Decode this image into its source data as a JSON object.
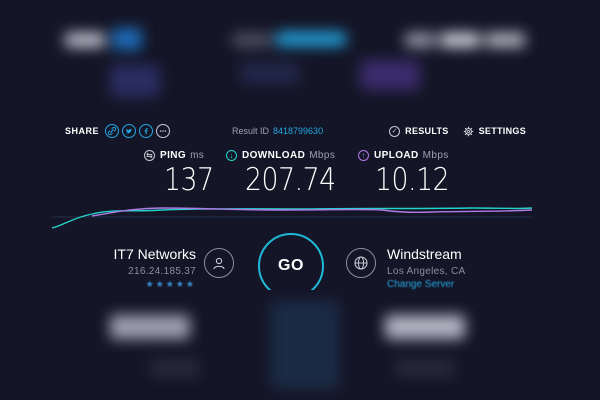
{
  "share": {
    "label": "SHARE",
    "buttons": [
      {
        "icon": "link-icon",
        "name": "share-link-button"
      },
      {
        "icon": "twitter-icon",
        "name": "share-twitter-button"
      },
      {
        "icon": "facebook-icon",
        "name": "share-facebook-button"
      },
      {
        "icon": "more-icon",
        "name": "share-more-button"
      }
    ]
  },
  "result": {
    "label": "Result ID",
    "id": "8418799630"
  },
  "nav": {
    "results_label": "RESULTS",
    "settings_label": "SETTINGS"
  },
  "metrics": {
    "ping": {
      "label": "PING",
      "unit": "ms",
      "value": "137"
    },
    "download": {
      "label": "DOWNLOAD",
      "unit": "Mbps",
      "value": "207.74"
    },
    "upload": {
      "label": "UPLOAD",
      "unit": "Mbps",
      "value": "10.12"
    }
  },
  "provider": {
    "name": "IT7 Networks",
    "ip": "216.24.185.37",
    "rating": 5
  },
  "server": {
    "name": "Windstream",
    "location": "Los Angeles, CA",
    "change_label": "Change Server"
  },
  "go_button": {
    "label": "GO"
  },
  "colors": {
    "background": "#141526",
    "accent_blue": "#23a7e3",
    "download_teal": "#23d3c8",
    "upload_purple": "#b07be6",
    "go_ring": "#1fb9d8",
    "muted_text": "#8d8ea0"
  }
}
